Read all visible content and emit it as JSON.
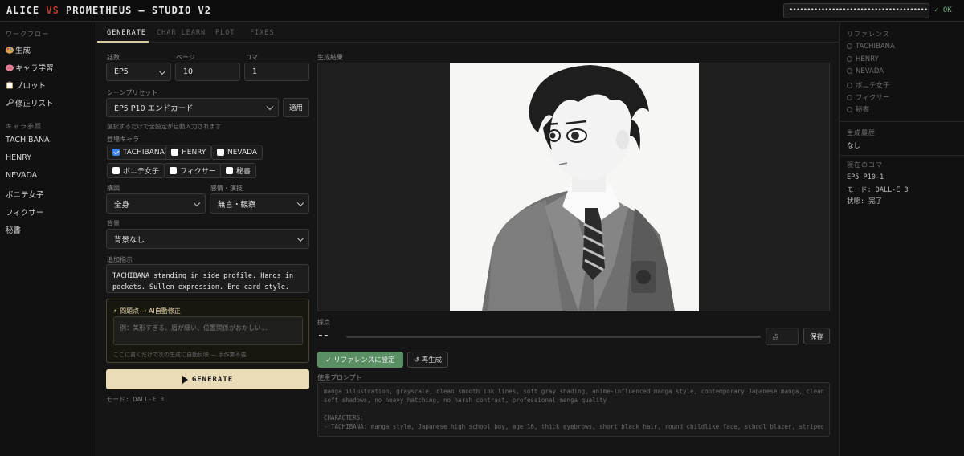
{
  "header": {
    "brand_a": "ALICE",
    "brand_vs": "VS",
    "brand_b": "PROMETHEUS — STUDIO V2",
    "api_key_masked": "••••••••••••••••••••••••••••••••••••••••",
    "status": "✓ OK"
  },
  "sidebar": {
    "workflow_title": "ワークフロー",
    "workflow_items": [
      {
        "label": "生成",
        "icon": "palette-icon"
      },
      {
        "label": "キャラ学習",
        "icon": "brain-icon"
      },
      {
        "label": "プロット",
        "icon": "clipboard-icon"
      },
      {
        "label": "修正リスト",
        "icon": "wrench-icon"
      }
    ],
    "char_title": "キャラ参照",
    "char_items": [
      "TACHIBANA",
      "HENRY",
      "NEVADA",
      "ボニテ女子",
      "フィクサー",
      "秘書"
    ]
  },
  "tabs": [
    {
      "label": "GENERATE",
      "active": true
    },
    {
      "label": "CHAR LEARN",
      "active": false
    },
    {
      "label": "PLOT",
      "active": false
    },
    {
      "label": "FIXES",
      "active": false
    }
  ],
  "form": {
    "episode_label": "話数",
    "episode_value": "EP5",
    "page_label": "ページ",
    "page_value": "10",
    "panel_label": "コマ",
    "panel_value": "1",
    "preset_label": "シーンプリセット",
    "preset_value": "EP5 P10 エンドカード",
    "apply_button": "適用",
    "preset_hint": "選択するだけで全設定が自動入力されます",
    "cast_label": "登場キャラ",
    "cast": [
      {
        "name": "TACHIBANA",
        "checked": true
      },
      {
        "name": "HENRY",
        "checked": false
      },
      {
        "name": "NEVADA",
        "checked": false
      },
      {
        "name": "ボニテ女子",
        "checked": false
      },
      {
        "name": "フィクサー",
        "checked": false
      },
      {
        "name": "秘書",
        "checked": false
      }
    ],
    "composition_label": "構図",
    "composition_value": "全身",
    "emotion_label": "感情・演技",
    "emotion_value": "無言・観察",
    "background_label": "背景",
    "background_value": "背景なし",
    "extra_label": "追加指示",
    "extra_text": "TACHIBANA standing in side profile. Hands in pockets. Sullen expression. End card style.",
    "fix_title": "⚡ 問題点 → AI自動修正",
    "fix_placeholder": "例：美形すぎる、眉が細い、位置関係がおかしい...",
    "fix_hint": "ここに書くだけで次の生成に自動反映 — 手作業不要",
    "generate_button": "GENERATE",
    "mode_text": "モード: DALL-E 3"
  },
  "result": {
    "title": "生成結果",
    "score_label": "採点",
    "score_value": "--",
    "score_placeholder": "点",
    "save_button": "保存",
    "reference_button": "✓ リファレンスに設定",
    "regenerate_button": "↺ 再生成",
    "prompt_label": "使用プロンプト",
    "prompt_lines": [
      "manga illustration, grayscale, clean smooth ink lines, soft gray shading, anime-influenced manga style, contemporary Japanese manga, clean lineart,",
      "soft shadows, no heavy hatching, no harsh contrast, professional manga quality",
      "",
      "CHARACTERS:",
      "- TACHIBANA: manga style, Japanese high school boy, age 16, thick eyebrows, short black hair, round childlike face, school blazer, striped tie, NOT"
    ]
  },
  "right_panel": {
    "reference_title": "リファレンス",
    "references": [
      "TACHIBANA",
      "HENRY",
      "NEVADA",
      "ボニテ女子",
      "フィクサー",
      "秘書"
    ],
    "history_title": "生成履歴",
    "history_value": "なし",
    "current_title": "現在のコマ",
    "current_panel": "EP5 P10-1",
    "current_mode": "モード: DALL-E 3",
    "current_state": "状態: 完了"
  },
  "colors": {
    "accent": "#e9dcb6",
    "reference_button": "#5a8f63",
    "vs": "#c0392b",
    "ok": "#6fae7d"
  }
}
